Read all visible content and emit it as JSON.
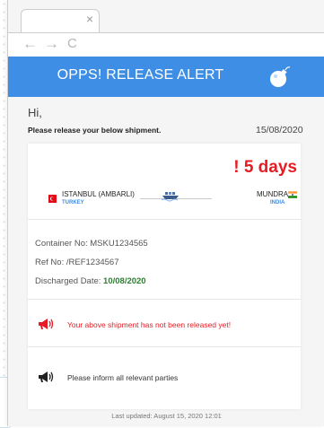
{
  "browser": {
    "tab_close_glyph": "×",
    "nav": {
      "back": "←",
      "forward": "→",
      "reload": "C"
    }
  },
  "banner": {
    "title": "OPPS! RELEASE ALERT",
    "icon": "bomb-icon",
    "color": "#3f8ee6"
  },
  "email": {
    "greeting": "Hi,",
    "intro": "Please release your below shipment.",
    "date": "15/08/2020",
    "days_badge": "! 5 days",
    "origin": {
      "port": "ISTANBUL (AMBARLI)",
      "country": "TURKEY",
      "flag_icon": "turkey-flag-icon"
    },
    "destination": {
      "port": "MUNDRA",
      "country": "INDIA",
      "flag_icon": "india-flag-icon"
    },
    "container_label": "Container No: ",
    "container_value": "MSKU1234565",
    "ref_label": "Ref No: ",
    "ref_value": "/REF1234567",
    "discharged_label": "Discharged Date: ",
    "discharged_value": "10/08/2020",
    "alert_text": "Your above shipment has not been released yet!",
    "inform_text": "Please inform all relevant parties",
    "footer": "Last updated: August 15, 2020 12:01"
  },
  "colors": {
    "alert_red": "#e51c23",
    "date_green": "#2e7d32"
  }
}
